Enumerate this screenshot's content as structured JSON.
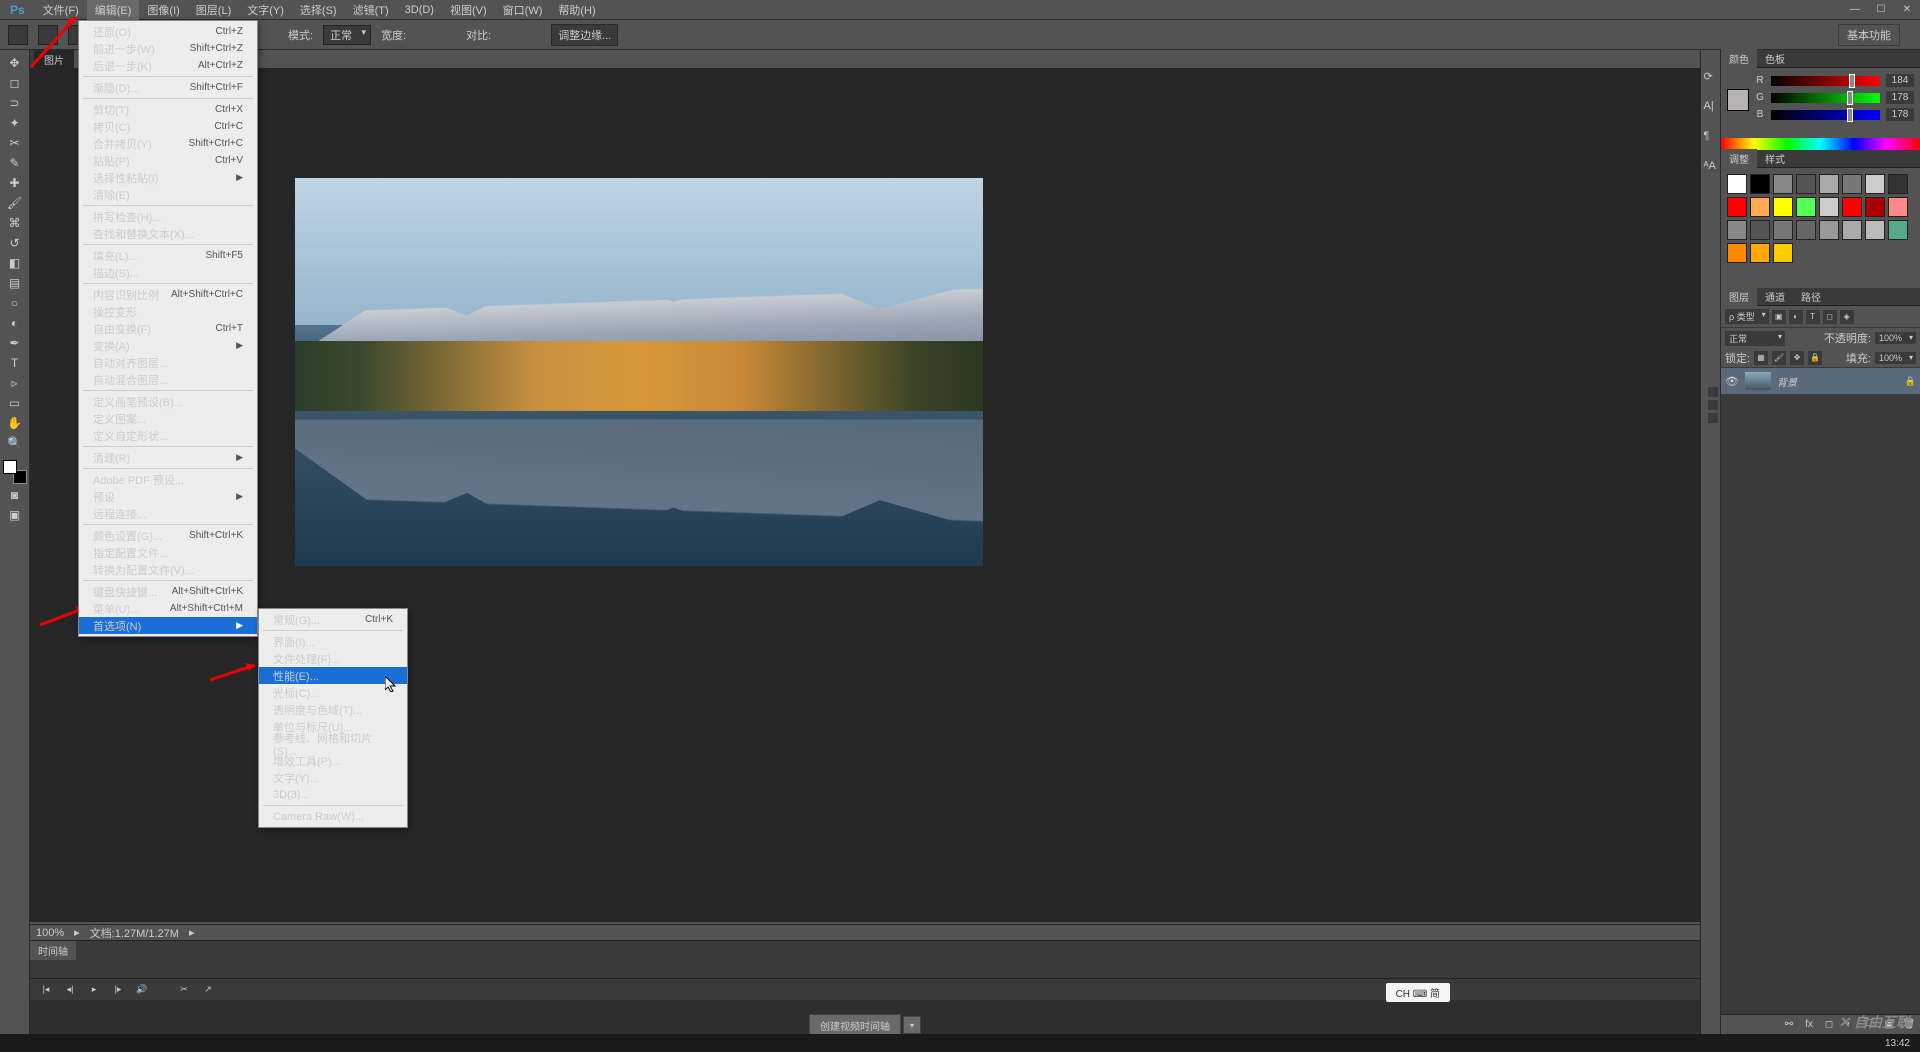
{
  "app": {
    "logo": "Ps"
  },
  "menubar": {
    "items": [
      "文件(F)",
      "编辑(E)",
      "图像(I)",
      "图层(L)",
      "文字(Y)",
      "选择(S)",
      "滤镜(T)",
      "3D(D)",
      "视图(V)",
      "窗口(W)",
      "帮助(H)"
    ],
    "activeIndex": 1
  },
  "optionsbar": {
    "mode_label": "模式:",
    "mode_value": "正常",
    "width_label": "宽度:",
    "contrast_label": "对比:",
    "refine_label": "调整边缘...",
    "right_chip": "基本功能"
  },
  "doc_tab": "图片",
  "edit_menu": [
    {
      "label": "还原(O)",
      "shortcut": "Ctrl+Z",
      "disabled": true
    },
    {
      "label": "前进一步(W)",
      "shortcut": "Shift+Ctrl+Z",
      "disabled": true
    },
    {
      "label": "后退一步(K)",
      "shortcut": "Alt+Ctrl+Z",
      "disabled": true
    },
    {
      "sep": true
    },
    {
      "label": "渐隐(D)...",
      "shortcut": "Shift+Ctrl+F",
      "disabled": true
    },
    {
      "sep": true
    },
    {
      "label": "剪切(T)",
      "shortcut": "Ctrl+X",
      "disabled": true
    },
    {
      "label": "拷贝(C)",
      "shortcut": "Ctrl+C",
      "disabled": true
    },
    {
      "label": "合并拷贝(Y)",
      "shortcut": "Shift+Ctrl+C",
      "disabled": true
    },
    {
      "label": "粘贴(P)",
      "shortcut": "Ctrl+V"
    },
    {
      "label": "选择性粘贴(I)",
      "arrow": true
    },
    {
      "label": "清除(E)",
      "disabled": true
    },
    {
      "sep": true
    },
    {
      "label": "拼写检查(H)...",
      "disabled": true
    },
    {
      "label": "查找和替换文本(X)...",
      "disabled": true
    },
    {
      "sep": true
    },
    {
      "label": "填充(L)...",
      "shortcut": "Shift+F5"
    },
    {
      "label": "描边(S)...",
      "disabled": true
    },
    {
      "sep": true
    },
    {
      "label": "内容识别比例",
      "shortcut": "Alt+Shift+Ctrl+C",
      "disabled": true
    },
    {
      "label": "操控变形",
      "disabled": true
    },
    {
      "label": "自由变换(F)",
      "shortcut": "Ctrl+T",
      "disabled": true
    },
    {
      "label": "变换(A)",
      "arrow": true,
      "disabled": true
    },
    {
      "label": "自动对齐图层...",
      "disabled": true
    },
    {
      "label": "自动混合图层...",
      "disabled": true
    },
    {
      "sep": true
    },
    {
      "label": "定义画笔预设(B)..."
    },
    {
      "label": "定义图案..."
    },
    {
      "label": "定义自定形状...",
      "disabled": true
    },
    {
      "sep": true
    },
    {
      "label": "清理(R)",
      "arrow": true
    },
    {
      "sep": true
    },
    {
      "label": "Adobe PDF 预设..."
    },
    {
      "label": "预设",
      "arrow": true
    },
    {
      "label": "远程连接..."
    },
    {
      "sep": true
    },
    {
      "label": "颜色设置(G)...",
      "shortcut": "Shift+Ctrl+K"
    },
    {
      "label": "指定配置文件..."
    },
    {
      "label": "转换为配置文件(V)..."
    },
    {
      "sep": true
    },
    {
      "label": "键盘快捷键...",
      "shortcut": "Alt+Shift+Ctrl+K"
    },
    {
      "label": "菜单(U)...",
      "shortcut": "Alt+Shift+Ctrl+M"
    },
    {
      "label": "首选项(N)",
      "arrow": true,
      "highlight": true
    }
  ],
  "prefs_submenu": [
    {
      "label": "常规(G)...",
      "shortcut": "Ctrl+K"
    },
    {
      "sep": true
    },
    {
      "label": "界面(I)..."
    },
    {
      "label": "文件处理(F)..."
    },
    {
      "label": "性能(E)...",
      "highlight": true
    },
    {
      "label": "光标(C)..."
    },
    {
      "label": "透明度与色域(T)..."
    },
    {
      "label": "单位与标尺(U)..."
    },
    {
      "label": "参考线、网格和切片(S)..."
    },
    {
      "label": "增效工具(P)..."
    },
    {
      "label": "文字(Y)..."
    },
    {
      "label": "3D(3)..."
    },
    {
      "sep": true
    },
    {
      "label": "Camera Raw(W)..."
    }
  ],
  "statusbar": {
    "zoom": "100%",
    "docinfo": "文档:1.27M/1.27M"
  },
  "timeline": {
    "tab": "时间轴",
    "button": "创建视频时间轴"
  },
  "color_panel": {
    "tabs": [
      "颜色",
      "色板"
    ],
    "r": {
      "label": "R",
      "value": "184"
    },
    "g": {
      "label": "G",
      "value": "178"
    },
    "b": {
      "label": "B",
      "value": "178"
    }
  },
  "swatches_panel": {
    "tabs": [
      "调整",
      "样式"
    ]
  },
  "swatch_colors": [
    "#fff",
    "#000",
    "#888",
    "#555",
    "#aaa",
    "#777",
    "#ccc",
    "#333",
    "#f00",
    "#fa5",
    "#ff0",
    "#5f5",
    "#ccc",
    "#f00",
    "#a00",
    "#f88",
    "#888",
    "#555",
    "#777",
    "#666",
    "#999",
    "#aaa",
    "#bbb",
    "#5a8",
    "#f80",
    "#fa0",
    "#fc0"
  ],
  "layers_panel": {
    "tabs": [
      "图层",
      "通道",
      "路径"
    ],
    "kind_filter": "ρ 类型",
    "blend_mode": "正常",
    "opacity_label": "不透明度:",
    "opacity_value": "100%",
    "lock_label": "锁定:",
    "fill_label": "填充:",
    "fill_value": "100%",
    "layer_name": "背景"
  },
  "ime": "CH ⌨ 简",
  "watermark": "✕ 自由互联",
  "taskbar_time": "13:42"
}
